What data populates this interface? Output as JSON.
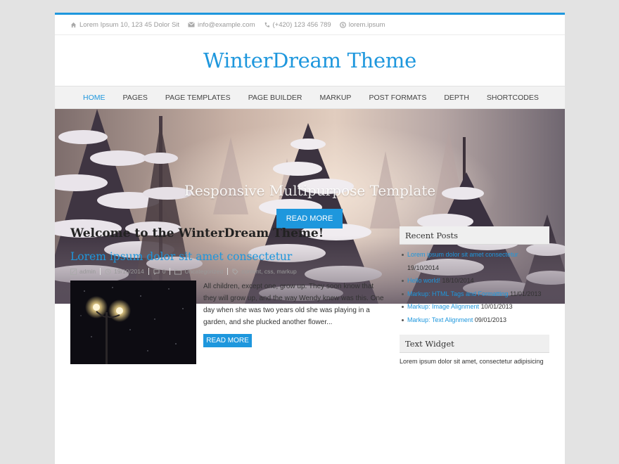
{
  "topbar": {
    "address": "Lorem Ipsum 10, 123 45 Dolor Sit",
    "email": "info@example.com",
    "phone": "(+420) 123 456 789",
    "skype": "lorem.ipsum"
  },
  "site_title": "WinterDream Theme",
  "nav": [
    "HOME",
    "PAGES",
    "PAGE TEMPLATES",
    "PAGE BUILDER",
    "MARKUP",
    "POST FORMATS",
    "DEPTH",
    "SHORTCODES"
  ],
  "hero": {
    "title": "Responsive Multipurpose Template",
    "button": "READ MORE"
  },
  "main": {
    "heading": "Welcome to the WinterDream Theme!",
    "post": {
      "title": "Lorem ipsum dolor sit amet consectetur",
      "author": "admin",
      "date": "19/10/2014",
      "comments": "0",
      "category": "Uncategorized",
      "tags": "content, css, markup",
      "excerpt": "All children, except one, grow up. They soon know that they will grow up, and the way Wendy knew was this. One day when she was two years old she was playing in a garden, and she plucked another flower...",
      "read_more": "READ MORE"
    }
  },
  "sidebar": {
    "recent_title": "Recent Posts",
    "recent_posts": [
      {
        "title": "Lorem ipsum dolor sit amet consectetur",
        "date": "19/10/2014"
      },
      {
        "title": "Hello world!",
        "date": "18/10/2014"
      },
      {
        "title": "Markup: HTML Tags and Formatting",
        "date": "11/01/2013"
      },
      {
        "title": "Markup: Image Alignment",
        "date": "10/01/2013"
      },
      {
        "title": "Markup: Text Alignment",
        "date": "09/01/2013"
      }
    ],
    "text_widget_title": "Text Widget",
    "text_widget_body": "Lorem ipsum dolor sit amet, consectetur adipisicing"
  },
  "colors": {
    "accent": "#1e97dd",
    "background": "#e3e3e3"
  },
  "icons": {
    "address": "home-icon",
    "email": "envelope-icon",
    "phone": "phone-icon",
    "skype": "skype-icon",
    "author": "user-icon",
    "date": "clock-icon",
    "comments": "comment-icon",
    "category": "folder-icon",
    "tags": "tag-icon"
  }
}
